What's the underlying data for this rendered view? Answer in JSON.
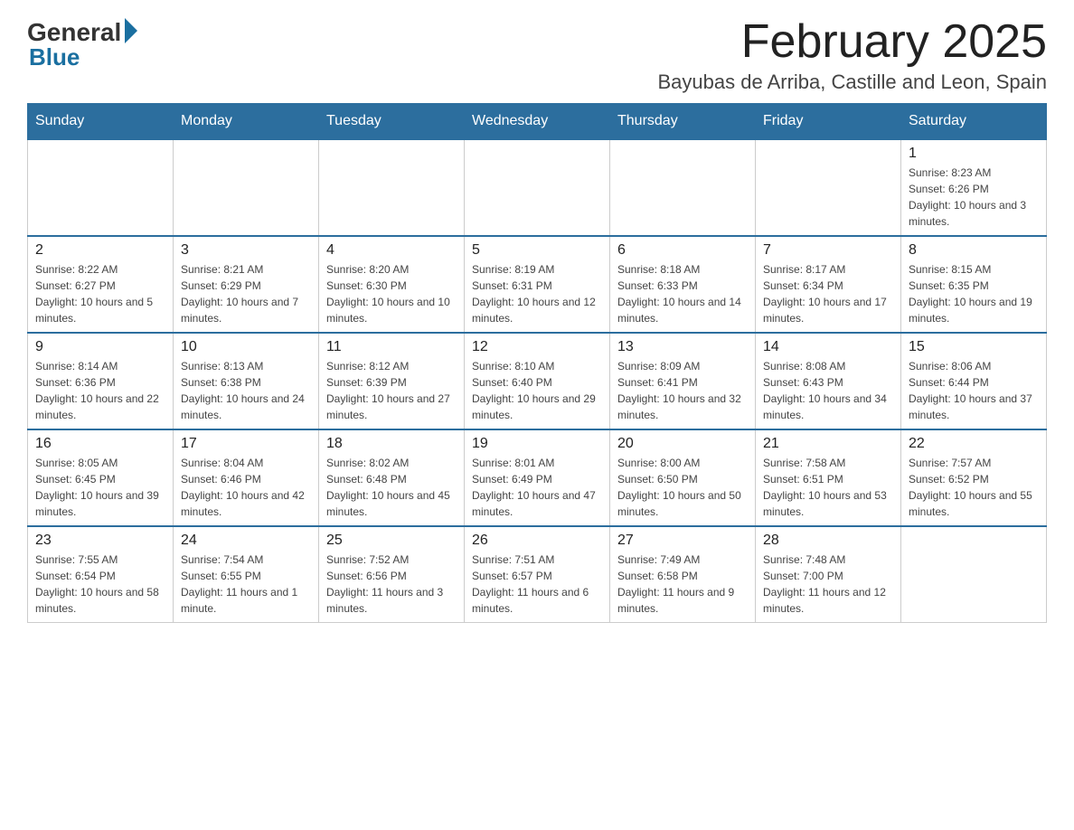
{
  "header": {
    "logo_general": "General",
    "logo_blue": "Blue",
    "month_title": "February 2025",
    "location": "Bayubas de Arriba, Castille and Leon, Spain"
  },
  "days_of_week": [
    "Sunday",
    "Monday",
    "Tuesday",
    "Wednesday",
    "Thursday",
    "Friday",
    "Saturday"
  ],
  "weeks": [
    {
      "days": [
        {
          "num": "",
          "info": ""
        },
        {
          "num": "",
          "info": ""
        },
        {
          "num": "",
          "info": ""
        },
        {
          "num": "",
          "info": ""
        },
        {
          "num": "",
          "info": ""
        },
        {
          "num": "",
          "info": ""
        },
        {
          "num": "1",
          "info": "Sunrise: 8:23 AM\nSunset: 6:26 PM\nDaylight: 10 hours and 3 minutes."
        }
      ]
    },
    {
      "days": [
        {
          "num": "2",
          "info": "Sunrise: 8:22 AM\nSunset: 6:27 PM\nDaylight: 10 hours and 5 minutes."
        },
        {
          "num": "3",
          "info": "Sunrise: 8:21 AM\nSunset: 6:29 PM\nDaylight: 10 hours and 7 minutes."
        },
        {
          "num": "4",
          "info": "Sunrise: 8:20 AM\nSunset: 6:30 PM\nDaylight: 10 hours and 10 minutes."
        },
        {
          "num": "5",
          "info": "Sunrise: 8:19 AM\nSunset: 6:31 PM\nDaylight: 10 hours and 12 minutes."
        },
        {
          "num": "6",
          "info": "Sunrise: 8:18 AM\nSunset: 6:33 PM\nDaylight: 10 hours and 14 minutes."
        },
        {
          "num": "7",
          "info": "Sunrise: 8:17 AM\nSunset: 6:34 PM\nDaylight: 10 hours and 17 minutes."
        },
        {
          "num": "8",
          "info": "Sunrise: 8:15 AM\nSunset: 6:35 PM\nDaylight: 10 hours and 19 minutes."
        }
      ]
    },
    {
      "days": [
        {
          "num": "9",
          "info": "Sunrise: 8:14 AM\nSunset: 6:36 PM\nDaylight: 10 hours and 22 minutes."
        },
        {
          "num": "10",
          "info": "Sunrise: 8:13 AM\nSunset: 6:38 PM\nDaylight: 10 hours and 24 minutes."
        },
        {
          "num": "11",
          "info": "Sunrise: 8:12 AM\nSunset: 6:39 PM\nDaylight: 10 hours and 27 minutes."
        },
        {
          "num": "12",
          "info": "Sunrise: 8:10 AM\nSunset: 6:40 PM\nDaylight: 10 hours and 29 minutes."
        },
        {
          "num": "13",
          "info": "Sunrise: 8:09 AM\nSunset: 6:41 PM\nDaylight: 10 hours and 32 minutes."
        },
        {
          "num": "14",
          "info": "Sunrise: 8:08 AM\nSunset: 6:43 PM\nDaylight: 10 hours and 34 minutes."
        },
        {
          "num": "15",
          "info": "Sunrise: 8:06 AM\nSunset: 6:44 PM\nDaylight: 10 hours and 37 minutes."
        }
      ]
    },
    {
      "days": [
        {
          "num": "16",
          "info": "Sunrise: 8:05 AM\nSunset: 6:45 PM\nDaylight: 10 hours and 39 minutes."
        },
        {
          "num": "17",
          "info": "Sunrise: 8:04 AM\nSunset: 6:46 PM\nDaylight: 10 hours and 42 minutes."
        },
        {
          "num": "18",
          "info": "Sunrise: 8:02 AM\nSunset: 6:48 PM\nDaylight: 10 hours and 45 minutes."
        },
        {
          "num": "19",
          "info": "Sunrise: 8:01 AM\nSunset: 6:49 PM\nDaylight: 10 hours and 47 minutes."
        },
        {
          "num": "20",
          "info": "Sunrise: 8:00 AM\nSunset: 6:50 PM\nDaylight: 10 hours and 50 minutes."
        },
        {
          "num": "21",
          "info": "Sunrise: 7:58 AM\nSunset: 6:51 PM\nDaylight: 10 hours and 53 minutes."
        },
        {
          "num": "22",
          "info": "Sunrise: 7:57 AM\nSunset: 6:52 PM\nDaylight: 10 hours and 55 minutes."
        }
      ]
    },
    {
      "days": [
        {
          "num": "23",
          "info": "Sunrise: 7:55 AM\nSunset: 6:54 PM\nDaylight: 10 hours and 58 minutes."
        },
        {
          "num": "24",
          "info": "Sunrise: 7:54 AM\nSunset: 6:55 PM\nDaylight: 11 hours and 1 minute."
        },
        {
          "num": "25",
          "info": "Sunrise: 7:52 AM\nSunset: 6:56 PM\nDaylight: 11 hours and 3 minutes."
        },
        {
          "num": "26",
          "info": "Sunrise: 7:51 AM\nSunset: 6:57 PM\nDaylight: 11 hours and 6 minutes."
        },
        {
          "num": "27",
          "info": "Sunrise: 7:49 AM\nSunset: 6:58 PM\nDaylight: 11 hours and 9 minutes."
        },
        {
          "num": "28",
          "info": "Sunrise: 7:48 AM\nSunset: 7:00 PM\nDaylight: 11 hours and 12 minutes."
        },
        {
          "num": "",
          "info": ""
        }
      ]
    }
  ]
}
